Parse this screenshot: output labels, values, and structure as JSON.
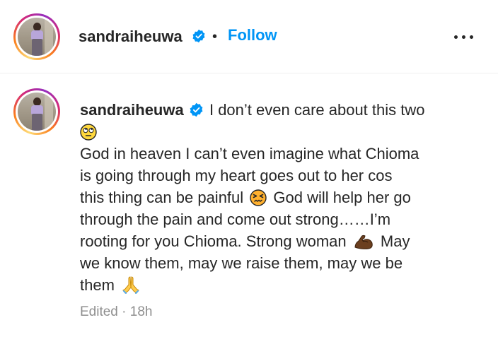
{
  "post_header": {
    "username": "sandraiheuwa",
    "separator": "•",
    "follow_label": "Follow"
  },
  "comment": {
    "username": "sandraiheuwa",
    "lines": {
      "l1": "I don’t even care about this two",
      "l2": "God in heaven I can’t even imagine what Chioma",
      "l3": "is going through my heart goes out to her cos",
      "l4a": "this thing can be painful",
      "l4b": "God will help her go",
      "l5": "through the pain and come out strong……I’m",
      "l6a": "rooting for you Chioma. Strong woman",
      "l6b": "May",
      "l7": "we know them, may we raise them, may we be",
      "l8": "them"
    },
    "emojis": [
      "face-with-rolling-eyes",
      "confounded-face",
      "flexed-biceps",
      "folded-hands"
    ],
    "edited_label": "Edited",
    "meta_separator": "·",
    "time_ago": "18h"
  },
  "colors": {
    "link_blue": "#0095f6",
    "verified_blue": "#0095f6",
    "text": "#262626",
    "muted": "#8e8e8e"
  }
}
